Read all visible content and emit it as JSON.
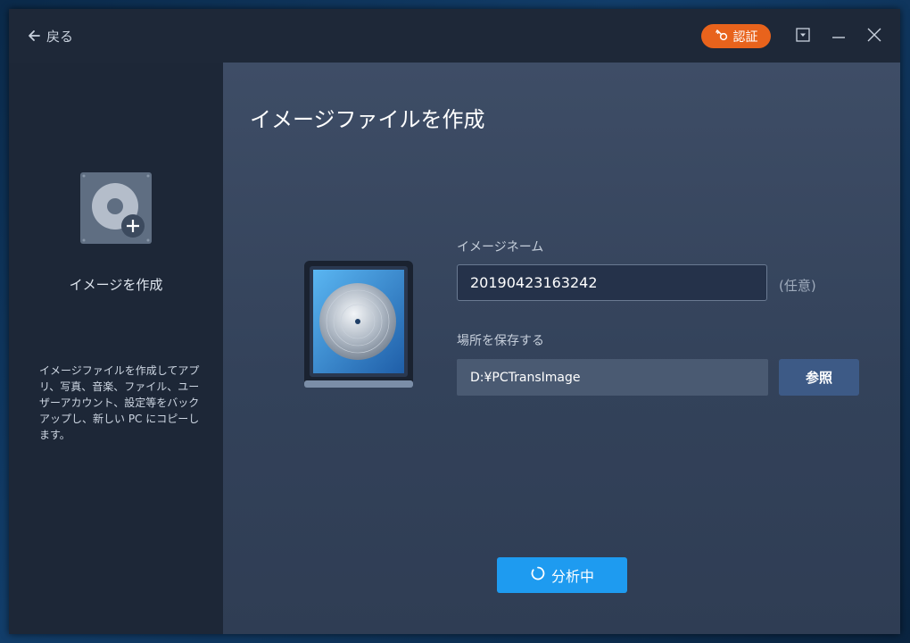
{
  "titlebar": {
    "back_label": "戻る",
    "auth_label": "認証",
    "icons": [
      "back-arrow-icon",
      "key-icon",
      "dropdown-icon",
      "minimize-icon",
      "close-icon"
    ]
  },
  "sidebar": {
    "title": "イメージを作成",
    "description": "イメージファイルを作成してアプリ、写真、音楽、ファイル、ユーザーアカウント、設定等をバックアップし、新しい PC にコピーします。"
  },
  "main": {
    "title": "イメージファイルを作成",
    "image_name_label": "イメージネーム",
    "image_name_value": "20190423163242",
    "optional_label": "(任意)",
    "save_location_label": "場所を保存する",
    "save_location_value": "D:¥PCTransImage",
    "browse_label": "参照",
    "analyze_label": "分析中"
  },
  "colors": {
    "accent_orange": "#e8631c",
    "accent_blue": "#1e9bf0",
    "browse_blue": "#3d5a86"
  }
}
